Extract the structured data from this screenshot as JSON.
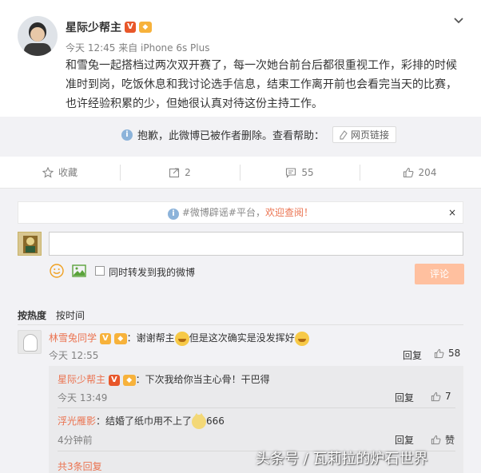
{
  "post": {
    "author": "星际少帮主",
    "author_v_badge": "V",
    "meta": "今天 12:45 来自 iPhone 6s Plus",
    "text": "和雪兔一起搭档过两次双开赛了，每一次她台前台后都很重视工作，彩排的时候准时到岗，吃饭休息和我讨论选手信息，结束工作离开前也会看完当天的比赛，也许经验积累的少，但她很认真对待这份主持工作。",
    "deleted_notice": "抱歉，此微博已被作者删除。查看帮助：",
    "web_link": "网页链接"
  },
  "actions": {
    "favorite": "收藏",
    "repost": "2",
    "comments": "55",
    "likes": "204"
  },
  "comment_box": {
    "notice_prefix": "#微博辟谣#平台，",
    "notice_highlight": "欢迎查阅！",
    "notice_close": "×",
    "input_value": "",
    "repost_label": "同时转发到我的微博",
    "submit": "评论"
  },
  "sort": {
    "hot": "按热度",
    "time": "按时间"
  },
  "comments": [
    {
      "user": "林雪兔同学",
      "text_a": "：谢谢帮主",
      "text_b": "但是这次确实是没发挥好",
      "time": "今天 12:55",
      "reply": "回复",
      "likes": "58",
      "replies": [
        {
          "user": "星际少帮主",
          "text": "：下次我给你当主心骨！干巴得",
          "time": "今天 13:49",
          "reply": "回复",
          "likes": "7"
        },
        {
          "user": "浮光雁影",
          "text": "：结婚了纸巾用不上了",
          "text_tail": "666",
          "time": "4分钟前",
          "reply": "回复",
          "likes": "赞"
        }
      ],
      "more": "共3条回复"
    }
  ],
  "watermark": "头条号 / 瓦莉拉的炉石世界",
  "colors": {
    "accent": "#eb7350",
    "submit_disabled": "#ffc09f",
    "background_grey": "#f2f2f5"
  }
}
